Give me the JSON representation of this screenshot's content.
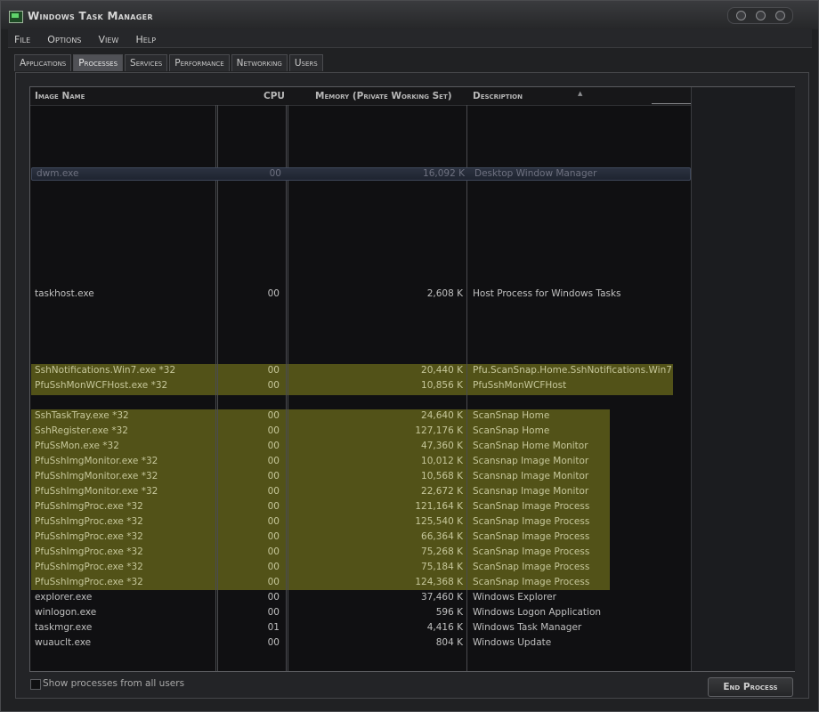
{
  "window": {
    "title": "Windows Task Manager"
  },
  "menu": [
    "File",
    "Options",
    "View",
    "Help"
  ],
  "tabs": [
    {
      "label": "Applications",
      "active": false
    },
    {
      "label": "Processes",
      "active": true
    },
    {
      "label": "Services",
      "active": false
    },
    {
      "label": "Performance",
      "active": false
    },
    {
      "label": "Networking",
      "active": false
    },
    {
      "label": "Users",
      "active": false
    }
  ],
  "columns": {
    "name": "Image Name",
    "cpu": "CPU",
    "memory": "Memory (Private Working Set)",
    "description": "Description"
  },
  "processes": [
    {
      "name": "dwm.exe",
      "cpu": "00",
      "mem": "16,092 K",
      "desc": "Desktop Window Manager",
      "selected": true
    },
    {
      "name": "taskhost.exe",
      "cpu": "00",
      "mem": "2,608 K",
      "desc": "Host Process for Windows Tasks"
    },
    {
      "name": "SshNotifications.Win7.exe *32",
      "cpu": "00",
      "mem": "20,440 K",
      "desc": "Pfu.ScanSnap.Home.SshNotifications.Win7",
      "highlight": true
    },
    {
      "name": "PfuSshMonWCFHost.exe *32",
      "cpu": "00",
      "mem": "10,856 K",
      "desc": "PfuSshMonWCFHost",
      "highlight": true
    },
    {
      "name": "SshTaskTray.exe *32",
      "cpu": "00",
      "mem": "24,640 K",
      "desc": "ScanSnap Home",
      "highlight": true
    },
    {
      "name": "SshRegister.exe *32",
      "cpu": "00",
      "mem": "127,176 K",
      "desc": "ScanSnap Home",
      "highlight": true
    },
    {
      "name": "PfuSsMon.exe *32",
      "cpu": "00",
      "mem": "47,360 K",
      "desc": "ScanSnap Home Monitor",
      "highlight": true
    },
    {
      "name": "PfuSshImgMonitor.exe *32",
      "cpu": "00",
      "mem": "10,012 K",
      "desc": "Scansnap Image Monitor",
      "highlight": true
    },
    {
      "name": "PfuSshImgMonitor.exe *32",
      "cpu": "00",
      "mem": "10,568 K",
      "desc": "Scansnap Image Monitor",
      "highlight": true
    },
    {
      "name": "PfuSshImgMonitor.exe *32",
      "cpu": "00",
      "mem": "22,672 K",
      "desc": "Scansnap Image Monitor",
      "highlight": true
    },
    {
      "name": "PfuSshImgProc.exe *32",
      "cpu": "00",
      "mem": "121,164 K",
      "desc": "ScanSnap Image Process",
      "highlight": true
    },
    {
      "name": "PfuSshImgProc.exe *32",
      "cpu": "00",
      "mem": "125,540 K",
      "desc": "ScanSnap Image Process",
      "highlight": true
    },
    {
      "name": "PfuSshImgProc.exe *32",
      "cpu": "00",
      "mem": "66,364 K",
      "desc": "ScanSnap Image Process",
      "highlight": true
    },
    {
      "name": "PfuSshImgProc.exe *32",
      "cpu": "00",
      "mem": "75,268 K",
      "desc": "ScanSnap Image Process",
      "highlight": true
    },
    {
      "name": "PfuSshImgProc.exe *32",
      "cpu": "00",
      "mem": "75,184 K",
      "desc": "ScanSnap Image Process",
      "highlight": true
    },
    {
      "name": "PfuSshImgProc.exe *32",
      "cpu": "00",
      "mem": "124,368 K",
      "desc": "ScanSnap Image Process",
      "highlight": true
    },
    {
      "name": "explorer.exe",
      "cpu": "00",
      "mem": "37,460 K",
      "desc": "Windows Explorer"
    },
    {
      "name": "winlogon.exe",
      "cpu": "00",
      "mem": "596 K",
      "desc": "Windows Logon Application"
    },
    {
      "name": "taskmgr.exe",
      "cpu": "01",
      "mem": "4,416 K",
      "desc": "Windows Task Manager"
    },
    {
      "name": "wuauclt.exe",
      "cpu": "00",
      "mem": "804 K",
      "desc": "Windows Update"
    }
  ],
  "footer": {
    "show_all_label": "Show processes from all users",
    "end_process_label": "End Process"
  },
  "colors": {
    "highlight": "#525218",
    "background": "#101012"
  }
}
